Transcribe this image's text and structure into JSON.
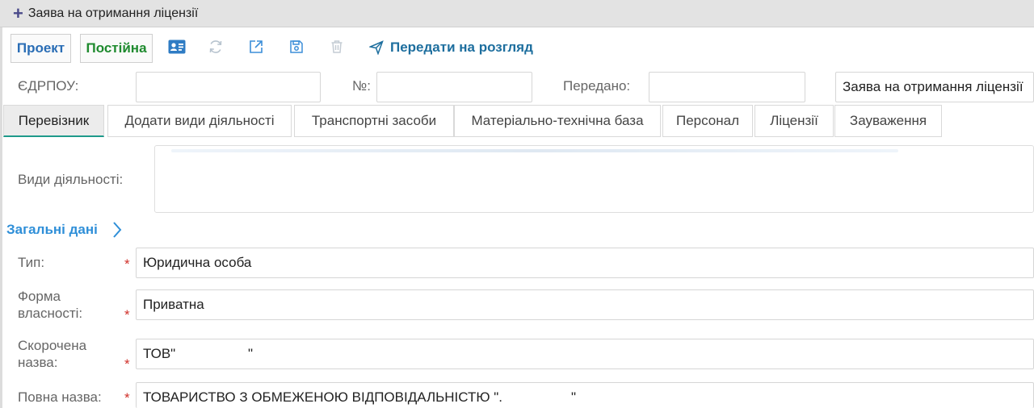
{
  "window": {
    "title": "Заява на отримання ліцензії"
  },
  "toolbar": {
    "status_project": "Проект",
    "status_permanent": "Постійна",
    "icons": [
      "id-card-icon",
      "refresh-icon",
      "external-link-icon",
      "save-icon",
      "trash-icon"
    ],
    "send_label": "Передати на розгляд"
  },
  "header_fields": {
    "edrpou_label": "ЄДРПОУ:",
    "edrpou_value": "",
    "number_label": "№:",
    "number_value": "",
    "submitted_label": "Передано:",
    "submitted_value": "",
    "doc_type_value": "Заява на отримання ліцензії"
  },
  "tabs": [
    {
      "label": "Перевізник",
      "active": true
    },
    {
      "label": "Додати види діяльності",
      "active": false
    },
    {
      "label": "Транспортні засоби",
      "active": false
    },
    {
      "label": "Матеріально-технічна база",
      "active": false
    },
    {
      "label": "Персонал",
      "active": false
    },
    {
      "label": "Ліцензії",
      "active": false
    },
    {
      "label": "Зауваження",
      "active": false
    }
  ],
  "activities": {
    "label": "Види діяльності:"
  },
  "general": {
    "section_title": "Загальні дані",
    "type_label": "Тип:",
    "type_value": "Юридична особа",
    "ownership_label_line1": "Форма",
    "ownership_label_line2": "власності:",
    "ownership_value": "Приватна",
    "short_name_label_line1": "Скорочена",
    "short_name_label_line2": "назва:",
    "short_name_value": "ТОВ\"                   \"",
    "full_name_label": "Повна назва:",
    "full_name_value": "ТОВАРИСТВО З ОБМЕЖЕНОЮ ВІДПОВІДАЛЬНІСТЮ \".                  \"",
    "required_mark": "*"
  },
  "colors": {
    "project_blue": "#2a6db5",
    "permanent_green": "#1e8a2e",
    "link_blue": "#1d6e9e",
    "section_blue": "#2f8fd8",
    "required_red": "#d0302a",
    "active_tab_underline": "#1e9a8a"
  }
}
